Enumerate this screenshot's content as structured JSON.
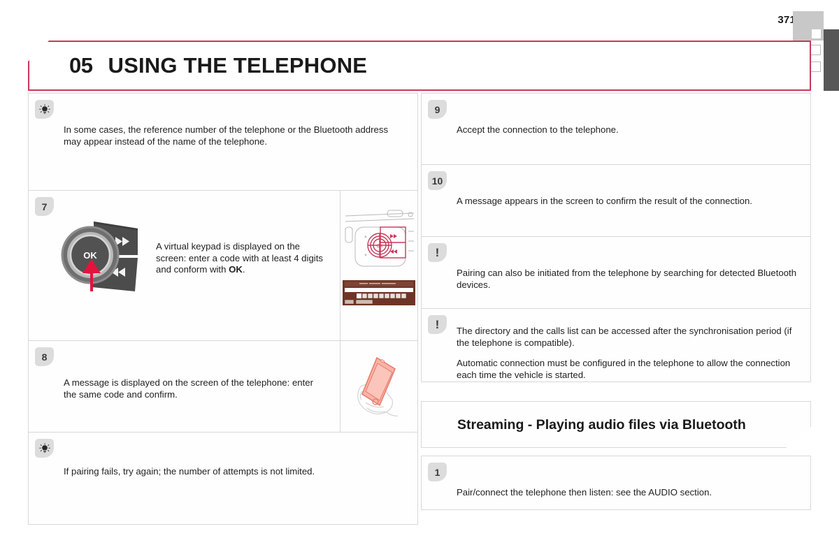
{
  "page": {
    "number": "371",
    "chapter_number": "05",
    "chapter_title": "USING THE TELEPHONE"
  },
  "icons": {
    "tip": "tip-lightbulb-icon",
    "warning": "warning-exclamation-icon",
    "tab_marker": "page-tab-marker",
    "side_box": "page-side-box-marker"
  },
  "left_column": {
    "blocks": [
      {
        "type": "tip",
        "badge": "",
        "paragraphs": [
          "In some cases, the reference number of the telephone or the Bluetooth address may appear instead of the name of the telephone."
        ]
      },
      {
        "type": "step",
        "badge": "7",
        "paragraphs": [
          "A virtual keypad is displayed on the screen: enter a code with at least 4 digits and conform with "
        ],
        "bold_tail": "OK",
        "tail": ".",
        "figure": "steering-control-ok-button",
        "side_figures": [
          "radio-fascia-controls",
          "screen-code-entry-keypad"
        ]
      },
      {
        "type": "step",
        "badge": "8",
        "paragraphs": [
          "A message is displayed on the screen of the telephone: enter the same code and confirm."
        ],
        "side_figures": [
          "hand-holding-telephone"
        ]
      },
      {
        "type": "tip",
        "badge": "",
        "paragraphs": [
          "If pairing fails, try again; the number of attempts is not limited."
        ]
      }
    ]
  },
  "right_column": {
    "blocks": [
      {
        "type": "step",
        "badge": "9",
        "paragraphs": [
          "Accept the connection to the telephone."
        ]
      },
      {
        "type": "step",
        "badge": "10",
        "paragraphs": [
          "A message appears in the screen to confirm the result of the connection."
        ]
      },
      {
        "type": "warning",
        "badge": "!",
        "paragraphs": [
          "Pairing can also be initiated from the telephone by searching for detected Bluetooth devices."
        ]
      },
      {
        "type": "warning",
        "badge": "!",
        "paragraphs": [
          "The directory and the calls list can be accessed after the synchronisation period (if the telephone is compatible).",
          "Automatic connection must be configured in the telephone to allow the connection each time the vehicle is started."
        ]
      }
    ],
    "section": {
      "heading": "Streaming - Playing audio files via Bluetooth",
      "blocks": [
        {
          "type": "step",
          "badge": "1",
          "paragraphs": [
            "Pair/connect the telephone then listen: see the AUDIO section."
          ]
        }
      ]
    }
  },
  "colors": {
    "accent": "#c8385a",
    "badge_bg": "#dcdcdc",
    "border": "#d8d8d8",
    "edge_strip": "#575757",
    "tab_marker": "#c8c8c8",
    "phone_fill": "#f9b3a8",
    "screen_bg": "#6e3527"
  }
}
